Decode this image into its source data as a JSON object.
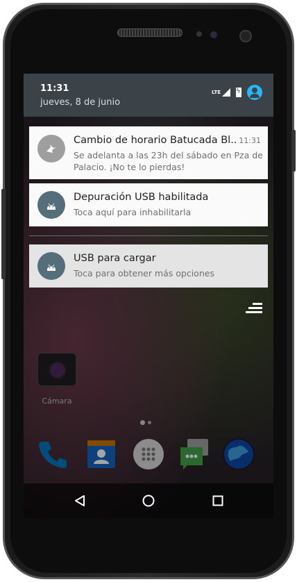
{
  "status_bar": {
    "time": "11:31",
    "date": "jueves, 8 de junio",
    "network": "LTE",
    "icons": [
      "lte-signal-icon",
      "battery-charging-icon",
      "user-avatar-icon"
    ]
  },
  "notifications": [
    {
      "title": "Cambio de horario Batucada Bl...",
      "time": "11:31",
      "text": "Se adelanta a las 23h del sábado en Pza de Palacio. ¡No te lo pierdas!",
      "icon": "app-notification-icon",
      "icon_color": "#9e9e9e"
    },
    {
      "title": "Depuración USB habilitada",
      "text": "Toca aquí para inhabilitarla",
      "icon": "android-debug-icon",
      "icon_color": "#546e7a"
    },
    {
      "title": "USB para cargar",
      "text": "Toca para obtener más opciones",
      "icon": "android-usb-icon",
      "icon_color": "#546e7a"
    }
  ],
  "home": {
    "camera_label": "Cámara",
    "dock_icons": [
      "phone-icon",
      "contacts-icon",
      "app-drawer-icon",
      "messenger-icon",
      "browser-icon"
    ]
  },
  "navigation": [
    "back-icon",
    "home-icon",
    "recents-icon"
  ],
  "colors": {
    "shade_header": "#3b4348",
    "accent": "#29b6f6",
    "notification_bg": "#fafafa"
  }
}
